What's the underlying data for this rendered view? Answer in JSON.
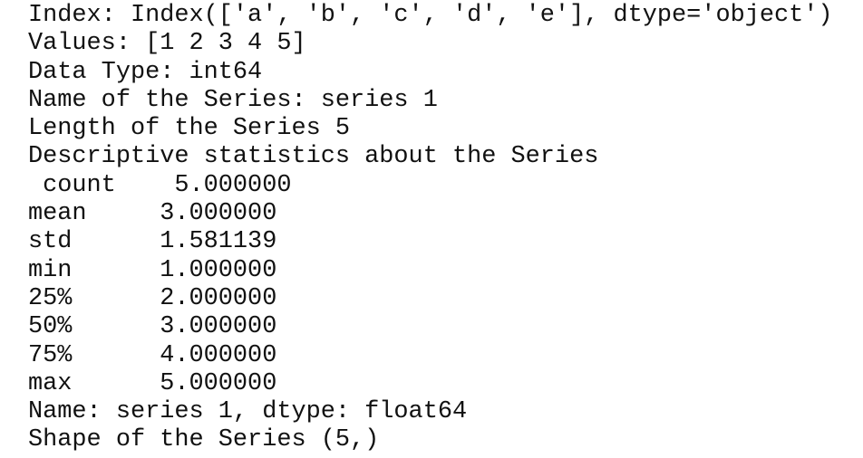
{
  "lines": [
    "Index: Index(['a', 'b', 'c', 'd', 'e'], dtype='object')",
    "Values: [1 2 3 4 5]",
    "Data Type: int64",
    "Name of the Series: series 1",
    "Length of the Series 5",
    "Descriptive statistics about the Series",
    " count    5.000000",
    "mean     3.000000",
    "std      1.581139",
    "min      1.000000",
    "25%      2.000000",
    "50%      3.000000",
    "75%      4.000000",
    "max      5.000000",
    "Name: series 1, dtype: float64",
    "Shape of the Series (5,)"
  ]
}
